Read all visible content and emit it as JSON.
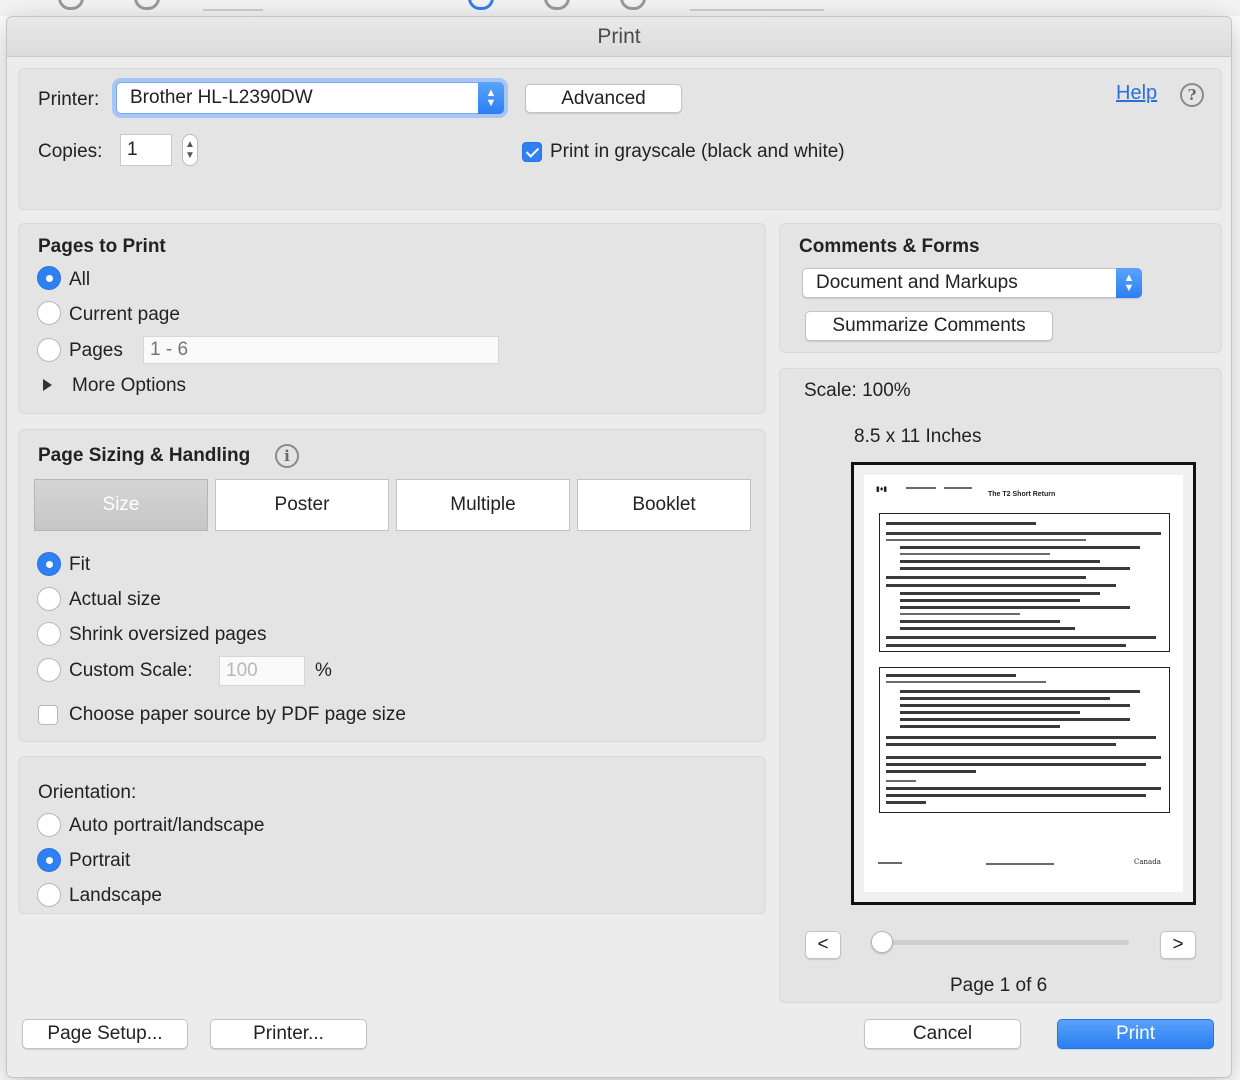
{
  "dialog": {
    "title": "Print"
  },
  "printer": {
    "label": "Printer:",
    "selected": "Brother HL-L2390DW",
    "advanced_label": "Advanced",
    "help_label": "Help"
  },
  "copies": {
    "label": "Copies:",
    "value": "1"
  },
  "grayscale": {
    "label": "Print in grayscale (black and white)",
    "checked": true
  },
  "pages_to_print": {
    "heading": "Pages to Print",
    "options": [
      {
        "label": "All",
        "selected": true
      },
      {
        "label": "Current page",
        "selected": false
      },
      {
        "label": "Pages",
        "selected": false
      }
    ],
    "pages_range_placeholder": "1 - 6",
    "more_options_label": "More Options"
  },
  "page_sizing": {
    "heading": "Page Sizing & Handling",
    "tabs": [
      {
        "label": "Size",
        "active": true
      },
      {
        "label": "Poster",
        "active": false
      },
      {
        "label": "Multiple",
        "active": false
      },
      {
        "label": "Booklet",
        "active": false
      }
    ],
    "options": [
      {
        "label": "Fit",
        "selected": true
      },
      {
        "label": "Actual size",
        "selected": false
      },
      {
        "label": "Shrink oversized pages",
        "selected": false
      },
      {
        "label": "Custom Scale:",
        "selected": false
      }
    ],
    "custom_scale_value": "100",
    "percent_sign": "%",
    "paper_source_label": "Choose paper source by PDF page size",
    "paper_source_checked": false
  },
  "orientation": {
    "heading": "Orientation:",
    "options": [
      {
        "label": "Auto portrait/landscape",
        "selected": false
      },
      {
        "label": "Portrait",
        "selected": true
      },
      {
        "label": "Landscape",
        "selected": false
      }
    ]
  },
  "comments_forms": {
    "heading": "Comments & Forms",
    "selected": "Document and Markups",
    "summarize_label": "Summarize Comments"
  },
  "preview": {
    "scale_label": "Scale: 100%",
    "paper_size": "8.5 x 11 Inches",
    "prev_label": "<",
    "next_label": ">",
    "page_indicator": "Page 1 of 6",
    "slider_position": 0,
    "doc_title": "The T2 Short Return",
    "footer_right": "Canada"
  },
  "footer": {
    "page_setup_label": "Page Setup...",
    "printer_label": "Printer...",
    "cancel_label": "Cancel",
    "print_label": "Print"
  },
  "colors": {
    "accent": "#2f80f2",
    "primary_button": "#2a7ef3",
    "link": "#2a6ee0"
  }
}
